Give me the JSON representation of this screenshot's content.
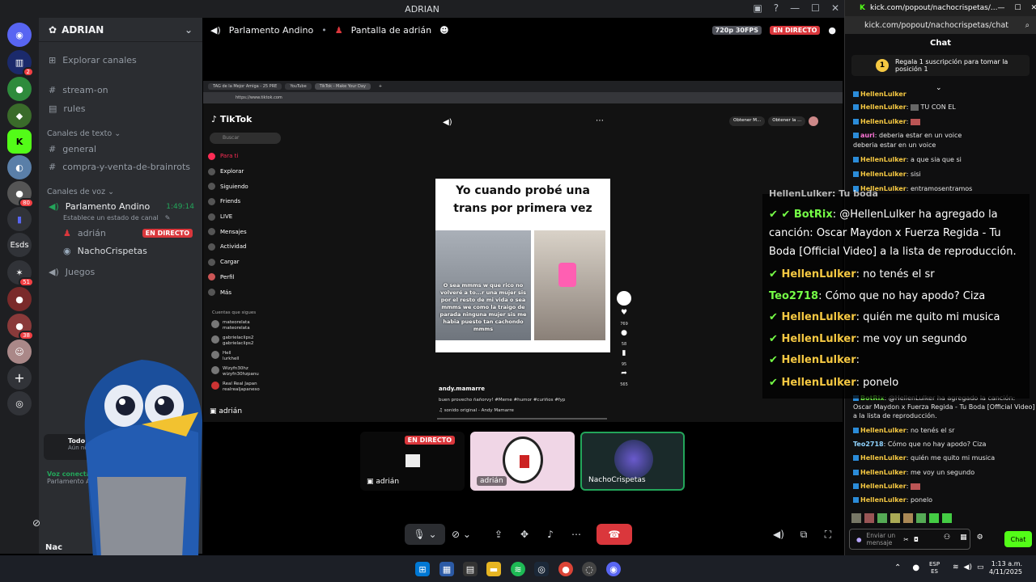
{
  "discord": {
    "window_title": "ADRIAN",
    "server_name": "ADRIAN",
    "explore": "Explorar canales",
    "channels_top": [
      {
        "name": "stream-on"
      },
      {
        "name": "rules"
      }
    ],
    "text_category": "Canales de texto",
    "text_channels": [
      {
        "name": "general"
      },
      {
        "name": "compra-y-venta-de-brainrots"
      }
    ],
    "voice_category": "Canales de voz",
    "voice_channel": {
      "name": "Parlamento Andino",
      "time": "1:49:14",
      "status": "Establece un estado de canal"
    },
    "voice_users": [
      {
        "name": "adrián",
        "badge": "EN DIRECTO"
      },
      {
        "name": "NachoCrispetas"
      }
    ],
    "games_channel": "Juegos",
    "activity_title": "Todo listo. Cu",
    "activity_sub": "Aún no hay progre",
    "voice_connected": "Voz conectac",
    "voice_connected_sub": "Parlamento And",
    "user_name": "Nac",
    "server_labels": {
      "esds": "Esds"
    },
    "badges": [
      "2",
      "80",
      "51",
      "38"
    ],
    "header": {
      "channel": "Parlamento Andino",
      "screen_share": "Pantalla de adrián",
      "quality": "720p 30FPS",
      "live": "EN DIRECTO"
    },
    "tiles": [
      {
        "name": "adrián",
        "live": "EN DIRECTO"
      },
      {
        "name": "adrián"
      },
      {
        "name": "NachoCrispetas"
      }
    ],
    "stream_label": "adrián"
  },
  "browser": {
    "tabs": [
      "TAG de la Mejor Amiga - 25 PRE",
      "YouTube",
      "TikTok - Make Your Day"
    ],
    "url": "https://www.tiktok.com",
    "tiktok": {
      "logo": "TikTok",
      "search": "Buscar",
      "nav": [
        "Para ti",
        "Explorar",
        "Siguiendo",
        "Friends",
        "LIVE",
        "Mensajes",
        "Actividad",
        "Cargar",
        "Perfil",
        "Más"
      ],
      "following_title": "Cuentas que sigues",
      "following": [
        {
          "name": "mateorelata",
          "handle": "mateorelata"
        },
        {
          "name": "gabrielaclips2",
          "handle": "gabrielaclips2"
        },
        {
          "name": "Hell",
          "handle": "lurkhell"
        },
        {
          "name": "Wizyfn30hz",
          "handle": "wizyfn30hzpanu"
        },
        {
          "name": "Real Real Japan",
          "handle": "realrealjapaneso"
        }
      ],
      "get_app_1": "Obtener M...",
      "get_app_2": "Obtener la ...",
      "video_caption": "Yo cuando probé una trans por primera vez",
      "video_overlay": "O sea mmms w que rico no volveré a to...r una mujer sis por el resto de mi vida o sea mmms we como la traigo de parada ninguna mujer sis me habia puesto tan cachondo mmms",
      "author": "andy.mamarre",
      "description": "buen provecho ñañorvy! #Meme #humor #curiños #fyp",
      "sound": "sonido original - Andy Mamarre",
      "counts": {
        "likes": "769",
        "comments": "58",
        "saves": "95",
        "shares": "565"
      }
    }
  },
  "kick": {
    "title": "kick.com/popout/nachocrispetas/...",
    "url": "kick.com/popout/nachocrispetas/chat",
    "header": "Chat",
    "pinned": "Regala 1 suscripción para tomar la posición 1",
    "pinned_num": "1",
    "messages": [
      {
        "user": "HellenLulker",
        "text": ""
      },
      {
        "user": "HellenLulker",
        "text": "TU CON EL"
      },
      {
        "user": "HellenLulker",
        "text": ""
      },
      {
        "user": "auri",
        "text": ": deberia estar en un voice"
      },
      {
        "user": "",
        "text": "deberia estar en un voice"
      },
      {
        "user": "HellenLulker",
        "text": ": a que sia que si"
      },
      {
        "user": "HellenLulker",
        "text": ": sisi"
      },
      {
        "user": "HellenLulker",
        "text": ": entramosentramos"
      },
      {
        "user": "HellenLulker",
        "text": ": no tenés el sr"
      },
      {
        "user": "Teo2718",
        "text": ": Cómo que no hay apodo? Ciza"
      },
      {
        "user": "HellenLulker",
        "text": ": quién me quito mi musica"
      },
      {
        "user": "HellenLulker",
        "text": ": me voy un segundo"
      },
      {
        "user": "HellenLulker",
        "text": ""
      },
      {
        "user": "HellenLulker",
        "text": ": ponelo"
      }
    ],
    "botrix": "BotRix",
    "botrix_text": ": @HellenLulker ha agregado la canción:",
    "botrix_text2": "Oscar Maydon x Fuerza Regida - Tu Boda [Official Video]",
    "botrix_text3": "a la lista de reproducción.",
    "input_placeholder": "Enviar un mensaje",
    "chat_button": "Chat"
  },
  "overlay": {
    "top_partial": "HellenLulker: Tu boda",
    "messages": [
      {
        "user": "BotRix",
        "text": ": @HellenLulker ha agregado la canción: Oscar Maydon x Fuerza Regida - Tu Boda [Official Video] a la lista de reproducción."
      },
      {
        "user": "HellenLulker",
        "text": ": no tenés el sr"
      },
      {
        "user": "Teo2718",
        "text": ": Cómo que no hay apodo? Ciza"
      },
      {
        "user": "HellenLulker",
        "text": ": quién me quito mi musica"
      },
      {
        "user": "HellenLulker",
        "text": ": me voy un segundo"
      },
      {
        "user": "HellenLulker",
        "text": ":"
      },
      {
        "user": "HellenLulker",
        "text": ": ponelo"
      }
    ]
  },
  "taskbar": {
    "lang": "ESP",
    "lang2": "ES",
    "time": "1:13 a.m.",
    "date": "4/11/2025"
  },
  "colors": {
    "discord_bg": "#313338",
    "live_red": "#da373c",
    "kick_green": "#53fc18"
  }
}
